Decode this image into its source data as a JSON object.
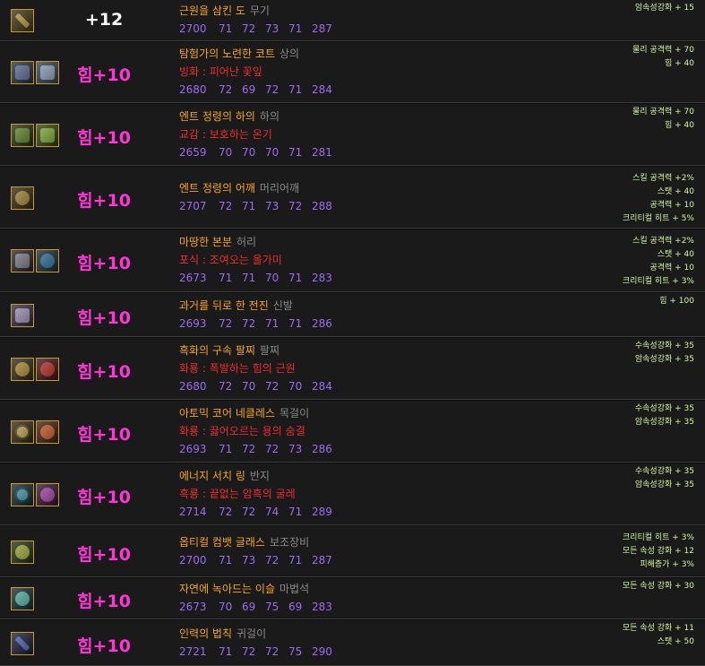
{
  "items": [
    {
      "icons": [
        "weapon"
      ],
      "upgrade": "+12",
      "upgrade_color": "#ffffff",
      "name": "근원을 삼킨 도",
      "category": "무기",
      "enchant": "",
      "stats": [
        "2700",
        "71",
        "72",
        "73",
        "71",
        "287"
      ],
      "bonus": [
        "암속성강화 + 15"
      ]
    },
    {
      "icons": [
        "coat",
        "coat2"
      ],
      "upgrade": "힘+10",
      "upgrade_color": "#ff35d8",
      "name": "탐험가의 노련한 코트",
      "category": "상의",
      "enchant": "빙화 : 피어난 꽃잎",
      "stats": [
        "2680",
        "72",
        "69",
        "72",
        "71",
        "284"
      ],
      "bonus": [
        "물리 공격력 + 70",
        "힘 + 40"
      ]
    },
    {
      "icons": [
        "leg",
        "leg2"
      ],
      "upgrade": "힘+10",
      "upgrade_color": "#ff35d8",
      "name": "엔트 정령의 하의",
      "category": "하의",
      "enchant": "교감 : 보호하는 온기",
      "stats": [
        "2659",
        "70",
        "70",
        "70",
        "71",
        "281"
      ],
      "bonus": [
        "물리 공격력 + 70",
        "힘 + 40"
      ]
    },
    {
      "icons": [
        "shoulder"
      ],
      "upgrade": "힘+10",
      "upgrade_color": "#ff35d8",
      "name": "엔트 정령의 어깨",
      "category": "머리어깨",
      "enchant": "",
      "stats": [
        "2707",
        "72",
        "71",
        "73",
        "72",
        "288"
      ],
      "bonus": [
        "스킬 공격력 +2%",
        "스탯 + 40",
        "공격력 + 10",
        "크리티컬 히트 + 5%"
      ]
    },
    {
      "icons": [
        "belt",
        "belt2"
      ],
      "upgrade": "힘+10",
      "upgrade_color": "#ff35d8",
      "name": "마땅한 본분",
      "category": "허리",
      "enchant": "포식 : 조여오는 올가미",
      "stats": [
        "2673",
        "71",
        "71",
        "70",
        "71",
        "283"
      ],
      "bonus": [
        "스킬 공격력 +2%",
        "스탯 + 40",
        "공격력 + 10",
        "크리티컬 히트 + 3%"
      ]
    },
    {
      "icons": [
        "shoe"
      ],
      "upgrade": "힘+10",
      "upgrade_color": "#ff35d8",
      "name": "과거를 뒤로 한 전진",
      "category": "신발",
      "enchant": "",
      "stats": [
        "2693",
        "72",
        "72",
        "71",
        "71",
        "286"
      ],
      "bonus": [
        "힘 + 100"
      ]
    },
    {
      "icons": [
        "brace",
        "brace2"
      ],
      "upgrade": "힘+10",
      "upgrade_color": "#ff35d8",
      "name": "흑화의 구속 팔찌",
      "category": "팔찌",
      "enchant": "화룡 : 폭발하는 힘의 근원",
      "stats": [
        "2680",
        "72",
        "70",
        "72",
        "70",
        "284"
      ],
      "bonus": [
        "수속성강화 + 35",
        "암속성강화 + 35"
      ]
    },
    {
      "icons": [
        "neck",
        "neck2"
      ],
      "upgrade": "힘+10",
      "upgrade_color": "#ff35d8",
      "name": "아토믹 코어 네클레스",
      "category": "목걸이",
      "enchant": "화룡 : 끓어오르는 용의 숨결",
      "stats": [
        "2693",
        "71",
        "72",
        "72",
        "73",
        "286"
      ],
      "bonus": [
        "수속성강화 + 35",
        "암속성강화 + 35"
      ]
    },
    {
      "icons": [
        "ring",
        "ring2"
      ],
      "upgrade": "힘+10",
      "upgrade_color": "#ff35d8",
      "name": "에너지 서치 링",
      "category": "반지",
      "enchant": "흑룡 : 끝없는 암흑의 굴레",
      "stats": [
        "2714",
        "72",
        "72",
        "74",
        "71",
        "289"
      ],
      "bonus": [
        "수속성강화 + 35",
        "암속성강화 + 35"
      ]
    },
    {
      "icons": [
        "sub"
      ],
      "upgrade": "힘+10",
      "upgrade_color": "#ff35d8",
      "name": "옵티컬 컴뱃 글래스",
      "category": "보조장비",
      "enchant": "",
      "stats": [
        "2700",
        "71",
        "73",
        "72",
        "71",
        "287"
      ],
      "bonus": [
        "크리티컬 히트 + 3%",
        "모든 속성 강화 + 12",
        "피해증가 + 3%"
      ]
    },
    {
      "icons": [
        "magic"
      ],
      "upgrade": "힘+10",
      "upgrade_color": "#ff35d8",
      "name": "자연에 녹아드는 이슬",
      "category": "마법석",
      "enchant": "",
      "stats": [
        "2673",
        "70",
        "69",
        "75",
        "69",
        "283"
      ],
      "bonus": [
        "모든 속성 강화 + 30"
      ]
    },
    {
      "icons": [
        "ear"
      ],
      "upgrade": "힘+10",
      "upgrade_color": "#ff35d8",
      "name": "인력의 법칙",
      "category": "귀걸이",
      "enchant": "",
      "stats": [
        "2721",
        "71",
        "72",
        "72",
        "75",
        "290"
      ],
      "bonus": [
        "모든 속성 강화 + 11",
        "스탯 + 50"
      ]
    }
  ]
}
